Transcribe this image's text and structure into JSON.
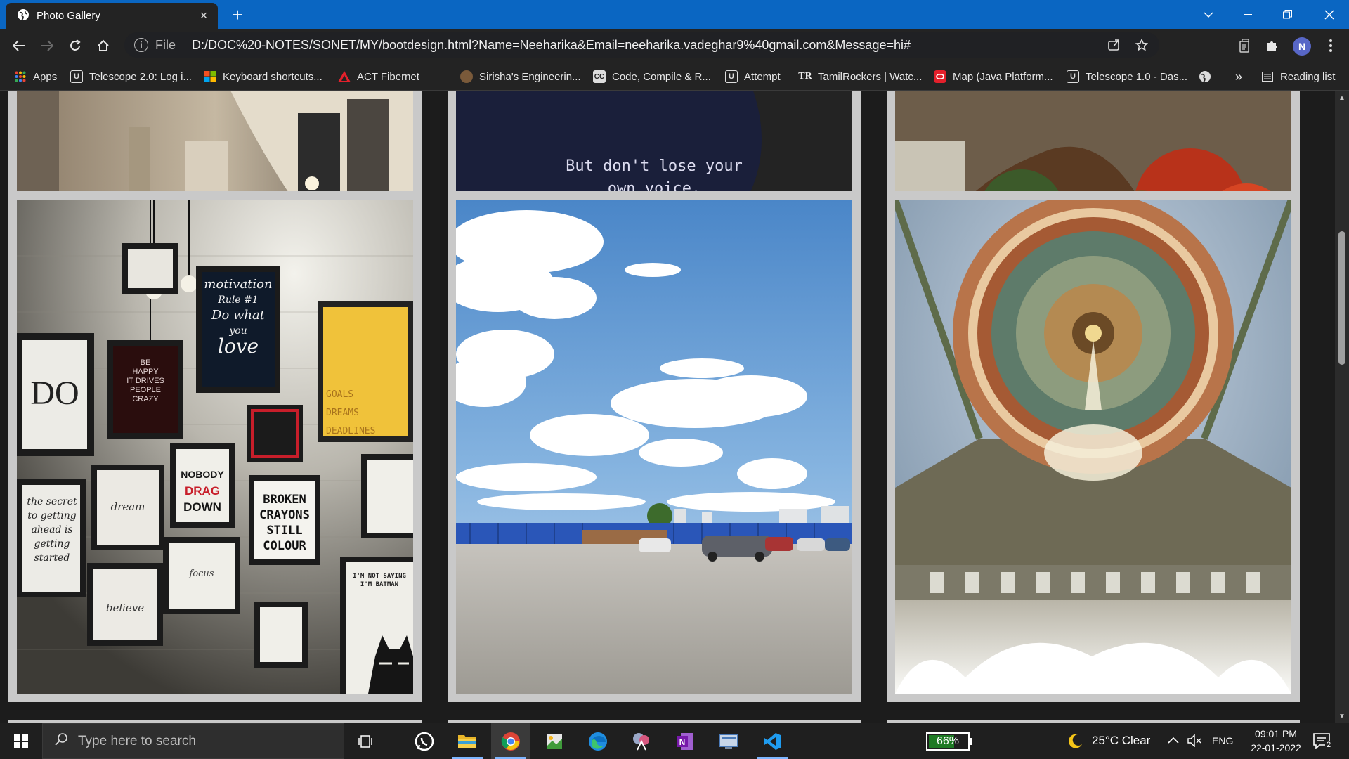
{
  "browser": {
    "tab_title": "Photo Gallery",
    "tab_close": "×",
    "new_tab": "+",
    "omnibox": {
      "scheme_label": "File",
      "url": "D:/DOC%20-NOTES/SONET/MY/bootdesign.html?Name=Neeharika&Email=neeharika.vadeghar9%40gmail.com&Message=hi#"
    },
    "profile_initial": "N",
    "bookmarks": [
      {
        "label": "Apps",
        "icon": "apps-grid-icon"
      },
      {
        "label": "Telescope 2.0: Log i...",
        "icon": "telescope-icon"
      },
      {
        "label": "Keyboard shortcuts...",
        "icon": "windows-logo-icon"
      },
      {
        "label": "ACT Fibernet",
        "icon": "act-logo-icon"
      },
      {
        "label": "Sirisha's Engineerin...",
        "icon": "profile-photo-icon"
      },
      {
        "label": "Code, Compile & R...",
        "icon": "cc-logo-icon"
      },
      {
        "label": "Attempt",
        "icon": "telescope-icon"
      },
      {
        "label": "TamilRockers | Watc...",
        "icon": "tr-logo-icon"
      },
      {
        "label": "Map (Java Platform...",
        "icon": "oracle-logo-icon"
      },
      {
        "label": "Telescope 1.0 - Das...",
        "icon": "telescope-icon"
      }
    ],
    "bookmarks_overflow": "»",
    "reading_list": "Reading list"
  },
  "gallery": {
    "quote_lines": [
      "But don't lose your",
      "own voice."
    ],
    "posters": {
      "do": "DO",
      "motivation": [
        "motivation",
        "Rule #1",
        "Do what",
        "you",
        "love"
      ],
      "happy": [
        "BE",
        "HAPPY",
        "IT DRIVES",
        "PEOPLE",
        "CRAZY"
      ],
      "goals": [
        "GOALS",
        "DREAMS",
        "DEADLINES"
      ],
      "nobody": [
        "NOBODY",
        "DRAG",
        "DOWN"
      ],
      "broken": [
        "BROKEN",
        "CRAYONS",
        "STILL",
        "COLOUR"
      ],
      "secret": [
        "the secret",
        "to getting",
        "ahead is",
        "getting",
        "started"
      ],
      "dream": "dream",
      "focus": "focus",
      "believe": "believe",
      "batman": [
        "I'M NOT SAYING",
        "I'M BATMAN"
      ]
    }
  },
  "taskbar": {
    "search_placeholder": "Type here to search",
    "battery_percent": "66%",
    "battery_level": 0.66,
    "weather": "25°C  Clear",
    "language": "ENG",
    "time": "09:01 PM",
    "date": "22-01-2022",
    "notification_count": "2"
  }
}
